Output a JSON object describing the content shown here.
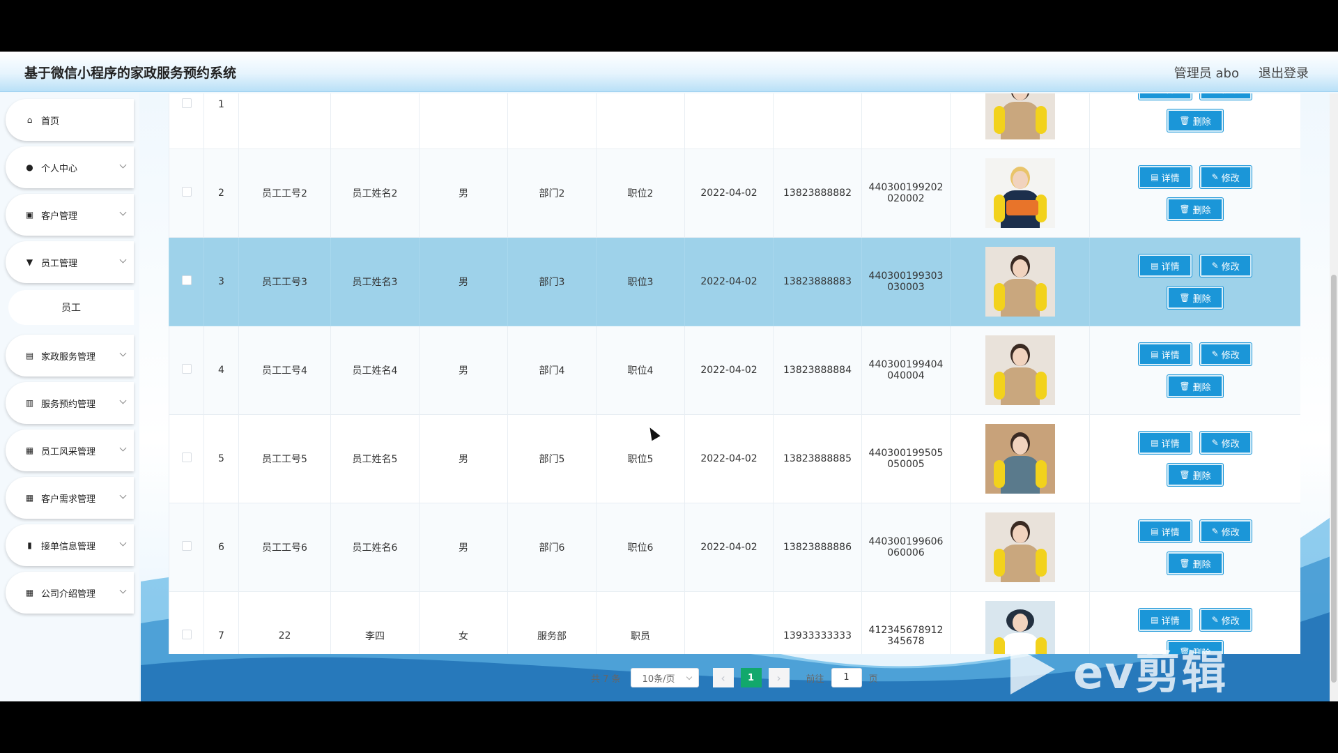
{
  "header": {
    "title": "基于微信小程序的家政服务预约系统",
    "admin_label": "管理员 abo",
    "logout_label": "退出登录"
  },
  "sidebar": {
    "items": [
      {
        "label": "首页",
        "icon": "home-icon"
      },
      {
        "label": "个人中心",
        "icon": "user-icon"
      },
      {
        "label": "客户管理",
        "icon": "clipboard-icon"
      },
      {
        "label": "员工管理",
        "icon": "flag-icon"
      },
      {
        "label": "家政服务管理",
        "icon": "document-icon"
      },
      {
        "label": "服务预约管理",
        "icon": "chart-icon"
      },
      {
        "label": "员工风采管理",
        "icon": "grid-icon"
      },
      {
        "label": "客户需求管理",
        "icon": "grid-icon"
      },
      {
        "label": "接单信息管理",
        "icon": "bar-chart-icon"
      },
      {
        "label": "公司介绍管理",
        "icon": "grid-icon"
      }
    ],
    "submenu": {
      "label": "员工"
    }
  },
  "table": {
    "actions": {
      "detail": "详情",
      "edit": "修改",
      "delete": "删除"
    },
    "rows": [
      {
        "index": "1",
        "emp_no": "",
        "name": "",
        "gender": "",
        "dept": "",
        "position": "",
        "date": "",
        "phone": "",
        "id_line1": "",
        "id_line2": ""
      },
      {
        "index": "2",
        "emp_no": "员工工号2",
        "name": "员工姓名2",
        "gender": "男",
        "dept": "部门2",
        "position": "职位2",
        "date": "2022-04-02",
        "phone": "13823888882",
        "id_line1": "440300199202",
        "id_line2": "020002"
      },
      {
        "index": "3",
        "emp_no": "员工工号3",
        "name": "员工姓名3",
        "gender": "男",
        "dept": "部门3",
        "position": "职位3",
        "date": "2022-04-02",
        "phone": "13823888883",
        "id_line1": "440300199303",
        "id_line2": "030003"
      },
      {
        "index": "4",
        "emp_no": "员工工号4",
        "name": "员工姓名4",
        "gender": "男",
        "dept": "部门4",
        "position": "职位4",
        "date": "2022-04-02",
        "phone": "13823888884",
        "id_line1": "440300199404",
        "id_line2": "040004"
      },
      {
        "index": "5",
        "emp_no": "员工工号5",
        "name": "员工姓名5",
        "gender": "男",
        "dept": "部门5",
        "position": "职位5",
        "date": "2022-04-02",
        "phone": "13823888885",
        "id_line1": "440300199505",
        "id_line2": "050005"
      },
      {
        "index": "6",
        "emp_no": "员工工号6",
        "name": "员工姓名6",
        "gender": "男",
        "dept": "部门6",
        "position": "职位6",
        "date": "2022-04-02",
        "phone": "13823888886",
        "id_line1": "440300199606",
        "id_line2": "060006"
      },
      {
        "index": "7",
        "emp_no": "22",
        "name": "李四",
        "gender": "女",
        "dept": "服务部",
        "position": "职员",
        "date": "",
        "phone": "13933333333",
        "id_line1": "412345678912",
        "id_line2": "345678"
      }
    ]
  },
  "pagination": {
    "total": "共 7 条",
    "page_size": "10条/页",
    "prev": "‹",
    "next": "›",
    "current_page": "1",
    "goto_label": "前往",
    "goto_value": "1",
    "page_suffix": "页"
  },
  "watermark": {
    "text": "ev剪辑"
  },
  "colors": {
    "accent": "#1b96d8",
    "highlight_row": "#9ed2ea",
    "page_active": "#12a86c"
  }
}
